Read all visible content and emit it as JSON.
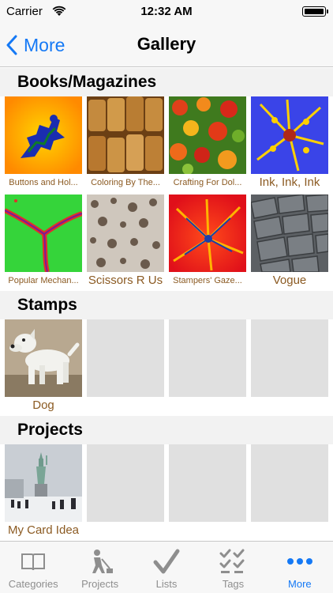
{
  "status_bar": {
    "carrier": "Carrier",
    "time": "12:32 AM"
  },
  "nav": {
    "back_label": "More",
    "title": "Gallery"
  },
  "sections": [
    {
      "title": "Books/Magazines",
      "items": [
        {
          "caption": "Buttons and Hol...",
          "image": "fractal-blue-orange"
        },
        {
          "caption": "Coloring By The...",
          "image": "wooden-cylinders"
        },
        {
          "caption": "Crafting For Dol...",
          "image": "flower-field"
        },
        {
          "caption": "Ink, Ink, Ink",
          "image": "fractal-yellow-blue"
        },
        {
          "caption": "Popular Mechan...",
          "image": "fractal-green-red"
        },
        {
          "caption": "Scissors R Us",
          "image": "floral-fabric"
        },
        {
          "caption": "Stampers' Gaze...",
          "image": "fractal-red-star"
        },
        {
          "caption": "Vogue",
          "image": "slate-roof"
        }
      ]
    },
    {
      "title": "Stamps",
      "items": [
        {
          "caption": "Dog",
          "image": "dog-figurine"
        }
      ],
      "empty_slots": 3
    },
    {
      "title": "Projects",
      "items": [
        {
          "caption": "My Card Idea",
          "image": "statue-of-liberty-snow"
        }
      ],
      "empty_slots": 3
    }
  ],
  "tabs": [
    {
      "label": "Categories",
      "icon": "book-icon",
      "active": false
    },
    {
      "label": "Projects",
      "icon": "worker-icon",
      "active": false
    },
    {
      "label": "Lists",
      "icon": "checkmark-icon",
      "active": false
    },
    {
      "label": "Tags",
      "icon": "checklist-icon",
      "active": false
    },
    {
      "label": "More",
      "icon": "more-dots-icon",
      "active": true
    }
  ],
  "colors": {
    "accent": "#1579f5",
    "caption": "#8b5a22",
    "inactive_tab": "#8e8e8e"
  }
}
